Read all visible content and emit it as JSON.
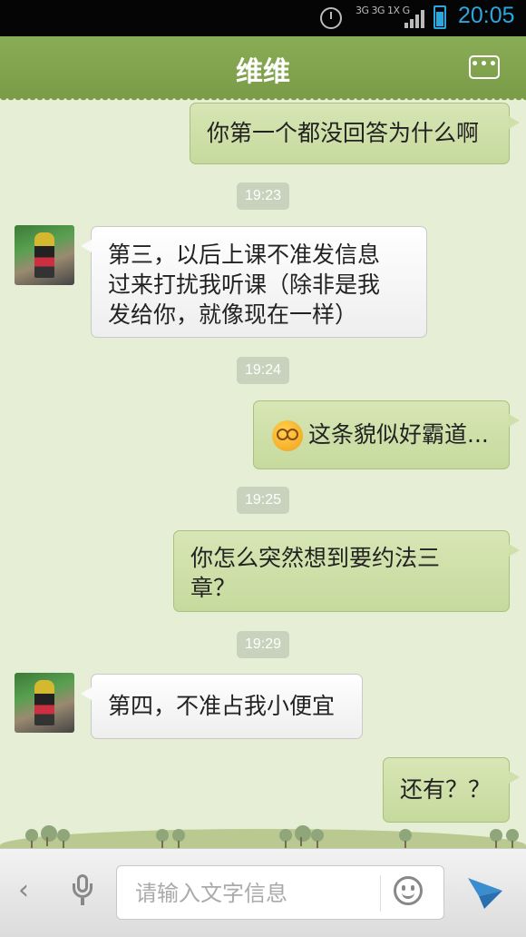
{
  "status_bar": {
    "network": "3G 3G 1X G",
    "time": "20:05"
  },
  "header": {
    "title": "维维"
  },
  "messages": [
    {
      "dir": "out",
      "text": "你第一个都没回答为什么啊"
    },
    {
      "type": "timestamp",
      "text": "19:23"
    },
    {
      "dir": "in",
      "lines": [
        "第三，以后上课不准发信息",
        "过来打扰我听课（除非是我",
        "发给你，就像现在一样）"
      ]
    },
    {
      "type": "timestamp",
      "text": "19:24"
    },
    {
      "dir": "out",
      "emoji": "dizzy-face-emoji",
      "text": "这条貌似好霸道..."
    },
    {
      "type": "timestamp",
      "text": "19:25"
    },
    {
      "dir": "out",
      "lines": [
        "你怎么突然想到要约法三",
        "章？"
      ]
    },
    {
      "type": "timestamp",
      "text": "19:29"
    },
    {
      "dir": "in",
      "text": "第四，不准占我小便宜"
    },
    {
      "dir": "out",
      "text": "还有？？"
    }
  ],
  "input_bar": {
    "placeholder": "请输入文字信息",
    "back_glyph": "‹"
  },
  "colors": {
    "header": "#7a9c48",
    "background": "#e6eed6",
    "outgoing_bubble": "#cfe0ab",
    "time_accent": "#29a8e0"
  },
  "icons": [
    "alarm-icon",
    "signal-icon",
    "battery-icon",
    "more-menu-icon",
    "back-icon",
    "microphone-icon",
    "emoji-icon",
    "send-icon"
  ]
}
